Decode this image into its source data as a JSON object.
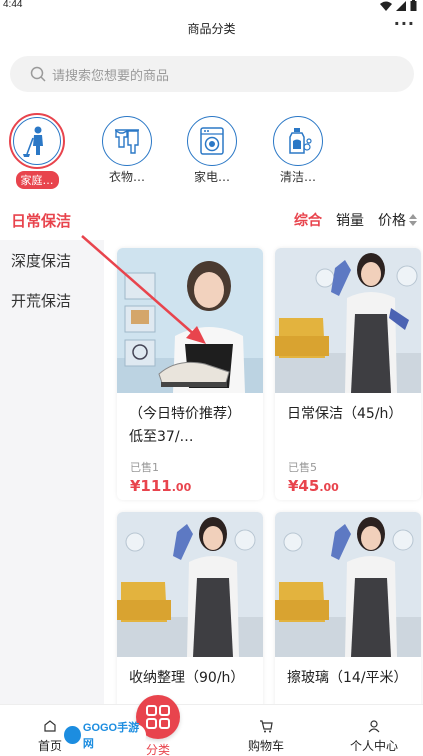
{
  "status": {
    "time": "4:44"
  },
  "header": {
    "title": "商品分类",
    "more": "···"
  },
  "search": {
    "placeholder": "请搜索您想要的商品"
  },
  "categories": [
    {
      "label": "家庭…",
      "icon": "cleaner-icon",
      "active": true
    },
    {
      "label": "衣物…",
      "icon": "clothes-icon"
    },
    {
      "label": "家电…",
      "icon": "washing-machine-icon"
    },
    {
      "label": "清洁…",
      "icon": "detergent-icon"
    }
  ],
  "sidebar": {
    "items": [
      {
        "label": "日常保洁",
        "active": true
      },
      {
        "label": "深度保洁"
      },
      {
        "label": "开荒保洁"
      }
    ]
  },
  "sort": {
    "composite": "综合",
    "sales": "销量",
    "price": "价格"
  },
  "products": [
    {
      "name": "（今日特价推荐）低至37/…",
      "sold": "已售1",
      "price_int": "¥111",
      "price_dec": ".00"
    },
    {
      "name": "日常保洁（45/h）",
      "sold": "已售5",
      "price_int": "¥45",
      "price_dec": ".00"
    },
    {
      "name": "收纳整理（90/h）",
      "sold": "",
      "price_int": "",
      "price_dec": ""
    },
    {
      "name": "擦玻璃（14/平米）",
      "sold": "",
      "price_int": "",
      "price_dec": ""
    }
  ],
  "tabbar": {
    "home": "首页",
    "category": "分类",
    "cart": "购物车",
    "profile": "个人中心"
  },
  "watermark": {
    "text": "GOGO手游网"
  },
  "colors": {
    "accent": "#e8444d",
    "icon_blue": "#2b78c6",
    "sidebar_bg": "#f5f5f7"
  }
}
